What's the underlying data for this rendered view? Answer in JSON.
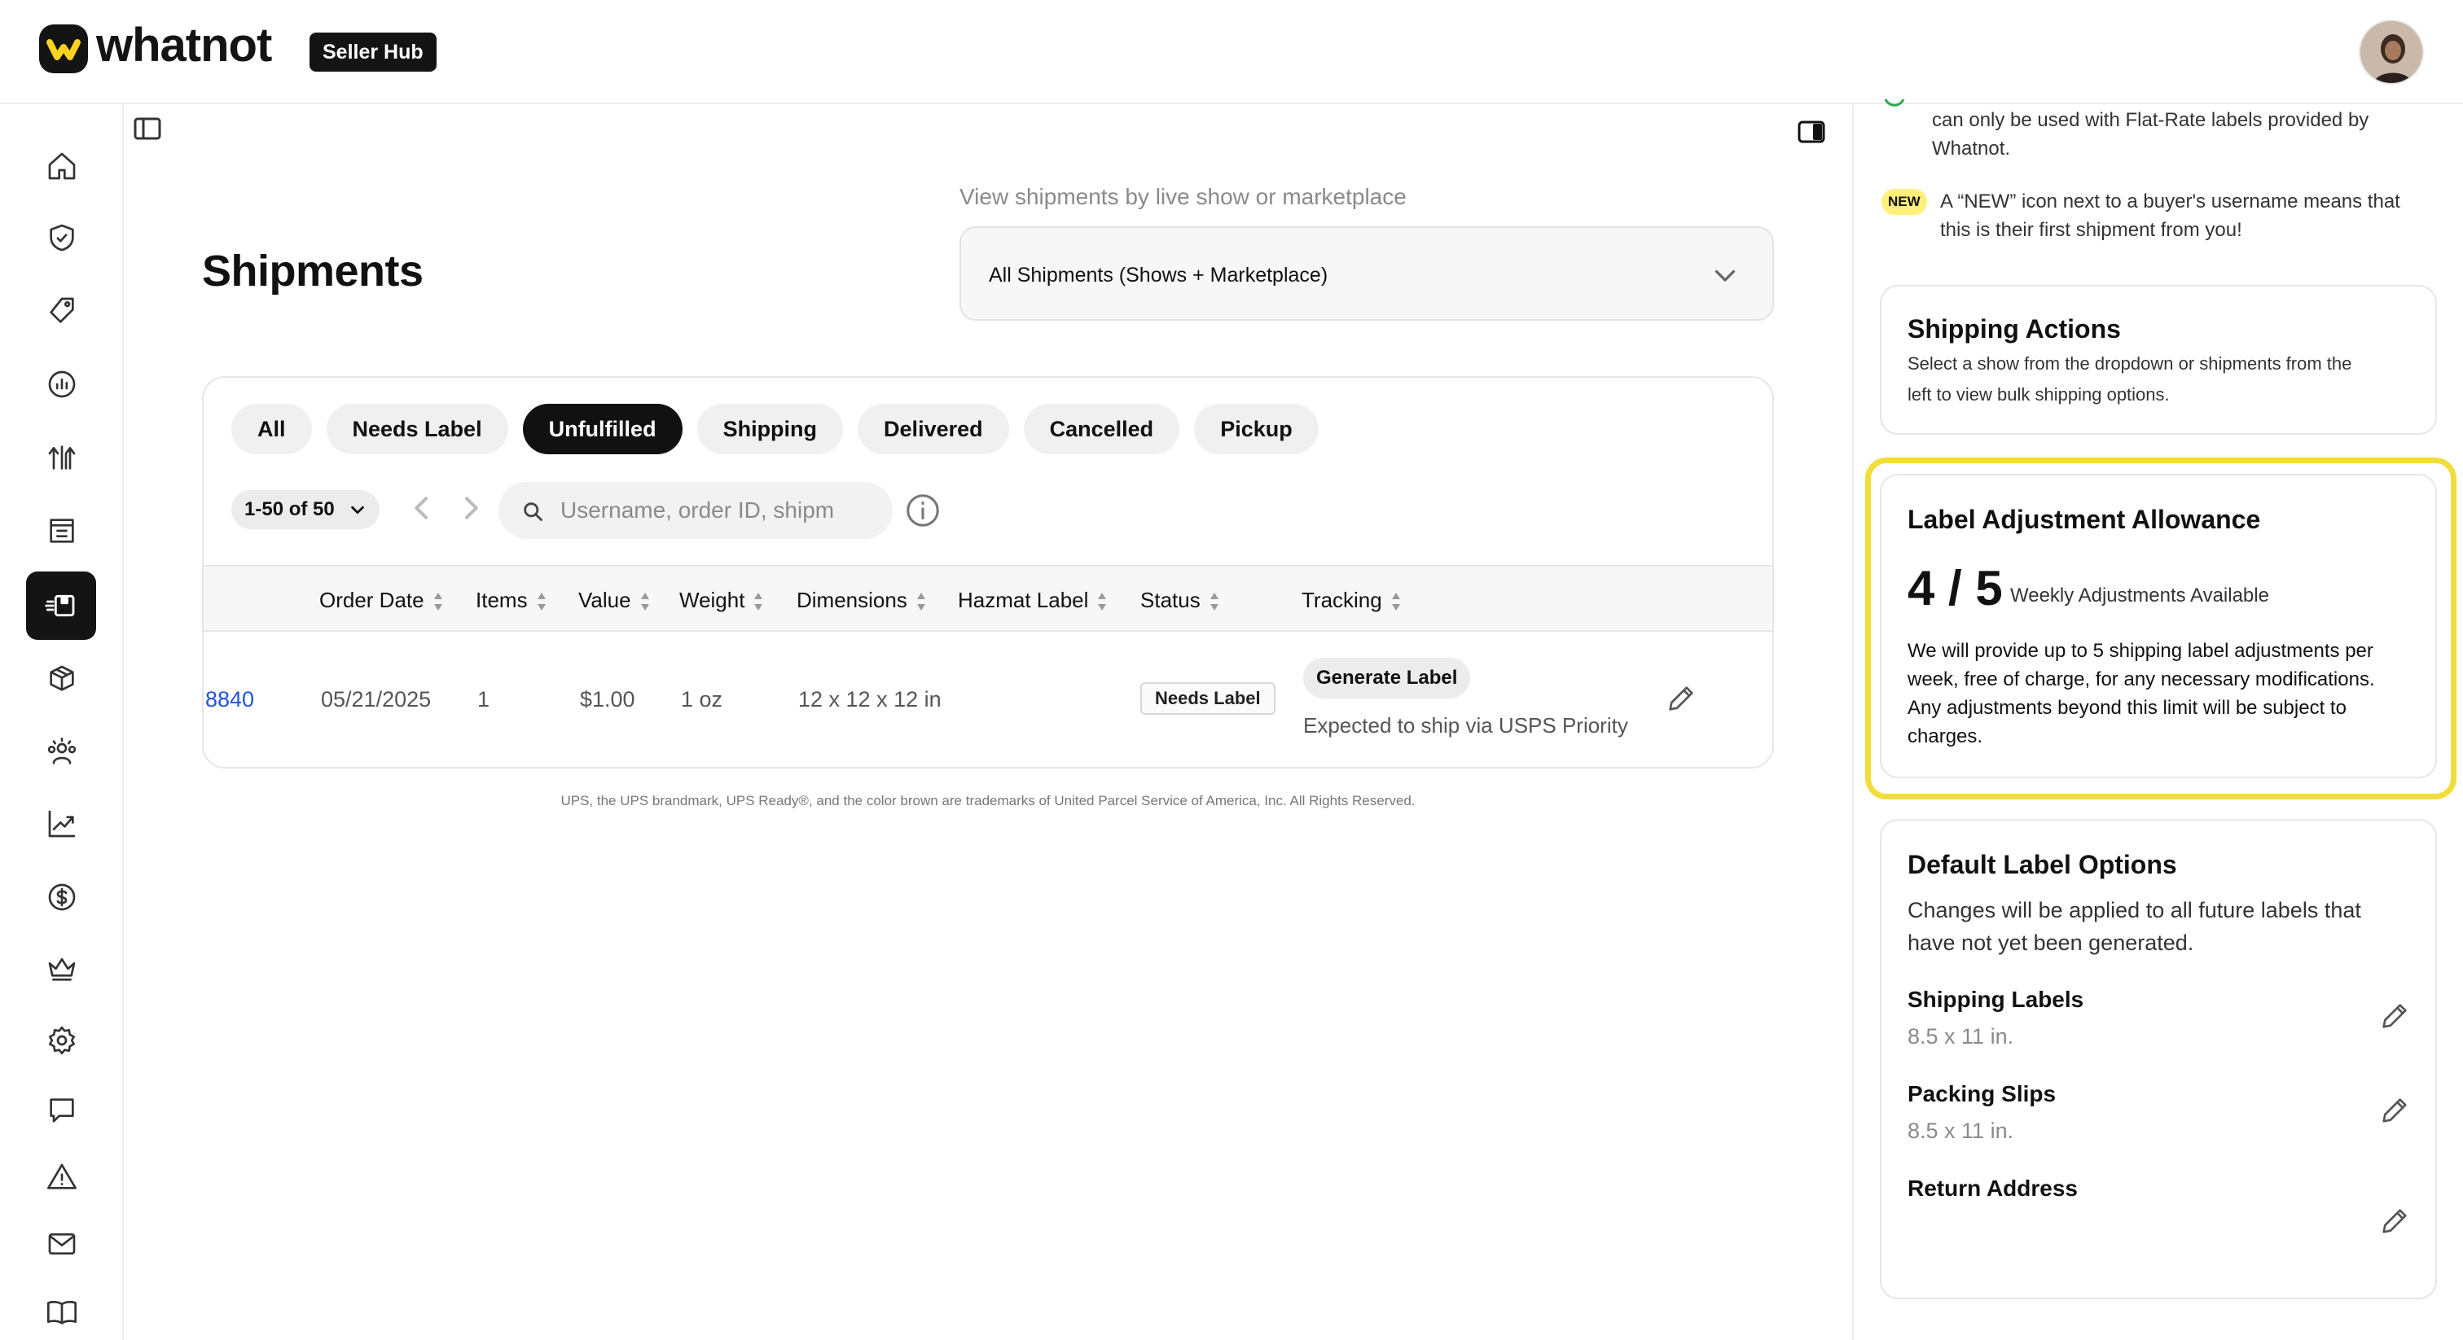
{
  "header": {
    "brand": "whatnot",
    "badge": "Seller Hub"
  },
  "nav": {
    "items": [
      {
        "name": "home-icon"
      },
      {
        "name": "shield-check-icon"
      },
      {
        "name": "tag-icon"
      },
      {
        "name": "analytics-icon"
      },
      {
        "name": "arrows-up-icon"
      },
      {
        "name": "storefront-icon"
      },
      {
        "name": "shipments-icon",
        "active": true
      },
      {
        "name": "boxes-icon"
      },
      {
        "name": "community-icon"
      },
      {
        "name": "chart-line-icon"
      },
      {
        "name": "dollar-icon"
      },
      {
        "name": "crown-icon"
      },
      {
        "name": "gear-icon"
      },
      {
        "name": "chat-icon"
      },
      {
        "name": "warning-icon"
      },
      {
        "name": "mail-icon"
      },
      {
        "name": "book-icon"
      }
    ]
  },
  "main": {
    "title": "Shipments",
    "view_label": "View shipments by live show or marketplace",
    "select_value": "All Shipments (Shows + Marketplace)",
    "tabs": [
      {
        "label": "All"
      },
      {
        "label": "Needs Label"
      },
      {
        "label": "Unfulfilled",
        "active": true
      },
      {
        "label": "Shipping"
      },
      {
        "label": "Delivered"
      },
      {
        "label": "Cancelled"
      },
      {
        "label": "Pickup"
      }
    ],
    "pager": "1-50 of 50",
    "search_placeholder": "Username, order ID, shipm",
    "columns": {
      "order_date": "Order Date",
      "items": "Items",
      "value": "Value",
      "weight": "Weight",
      "dimensions": "Dimensions",
      "hazmat": "Hazmat Label",
      "status": "Status",
      "tracking": "Tracking"
    },
    "row": {
      "order_id": "8840",
      "order_date": "05/21/2025",
      "items": "1",
      "value": "$1.00",
      "weight": "1 oz",
      "dimensions": "12 x 12 x 12 in",
      "status": "Needs Label",
      "generate_label": "Generate Label",
      "ship_note": "Expected to ship via USPS Priority"
    },
    "trademark": "UPS, the UPS brandmark, UPS Ready®, and the color brown are trademarks of United Parcel Service of America, Inc. All Rights Reserved."
  },
  "right_panel": {
    "intro_line1": "can only be used with Flat-Rate labels provided by",
    "intro_line2": "Whatnot.",
    "new_badge": "NEW",
    "new_line1": "A “NEW” icon next to a buyer's username means that",
    "new_line2": "this is their first shipment from you!",
    "shipping_actions": {
      "title": "Shipping Actions",
      "line1": "Select a show from the dropdown or shipments from the",
      "line2": "left to view bulk shipping options."
    },
    "allowance": {
      "title": "Label Adjustment Allowance",
      "count": "4 / 5",
      "count_label": "Weekly Adjustments Available",
      "line1": "We will provide up to 5 shipping label adjustments per",
      "line2": "week, free of charge, for any necessary modifications.",
      "line3": "Any adjustments beyond this limit will be subject to",
      "line4": "charges."
    },
    "defaults": {
      "title": "Default Label Options",
      "line1": "Changes will be applied to all future labels that",
      "line2": "have not yet been generated.",
      "shipping_labels_label": "Shipping Labels",
      "shipping_labels_value": "8.5 x 11 in.",
      "packing_slips_label": "Packing Slips",
      "packing_slips_value": "8.5 x 11 in.",
      "return_address_label": "Return Address"
    }
  },
  "colors": {
    "accent_dark": "#141414",
    "link_blue": "#1f55d6",
    "highlight_yellow": "#f2dd3c",
    "new_badge_yellow": "#fff07a"
  }
}
